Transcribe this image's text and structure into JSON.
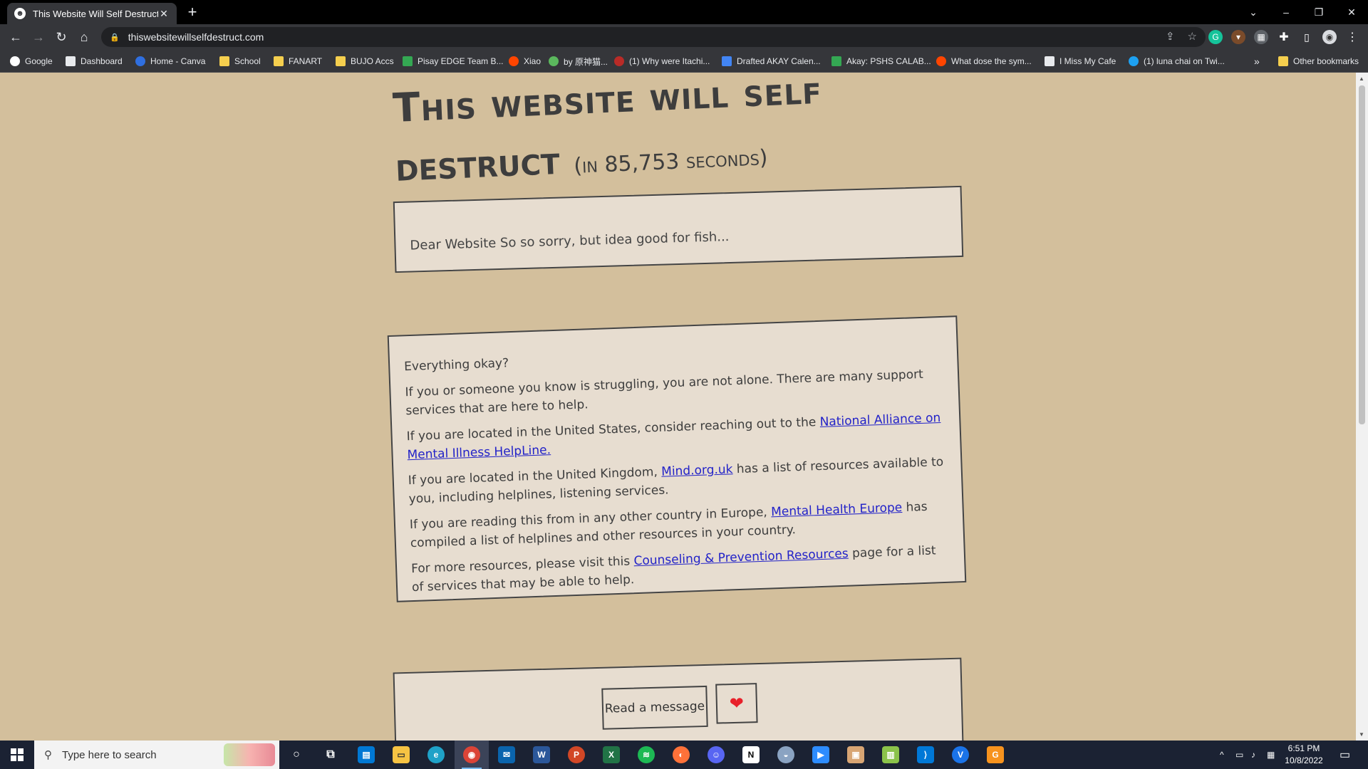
{
  "browser": {
    "tab_title": "This Website Will Self Destruct",
    "tab_close": "✕",
    "new_tab": "+",
    "url": "thiswebsitewillselfdestruct.com",
    "bookmarks": [
      {
        "label": "Google",
        "icon": "google-icon",
        "color": "#ffffff"
      },
      {
        "label": "Dashboard",
        "icon": "dashboard-icon",
        "color": "#e8eaed"
      },
      {
        "label": "Home - Canva",
        "icon": "canva-icon",
        "color": "#2f6fe0"
      },
      {
        "label": "School",
        "icon": "folder-icon",
        "color": "#f5cf4e"
      },
      {
        "label": "FANART",
        "icon": "folder-icon",
        "color": "#f5cf4e"
      },
      {
        "label": "BUJO Accs",
        "icon": "folder-icon",
        "color": "#f5cf4e"
      },
      {
        "label": "Pisay EDGE Team B...",
        "icon": "drive-icon",
        "color": "#34a853"
      },
      {
        "label": "Xiao",
        "icon": "reddit-icon",
        "color": "#ff4500"
      },
      {
        "label": "by 原神猫...",
        "icon": "leaf-icon",
        "color": "#5bb85d"
      },
      {
        "label": "(1) Why were Itachi...",
        "icon": "quora-icon",
        "color": "#b92b27"
      },
      {
        "label": "Drafted AKAY Calen...",
        "icon": "docs-icon",
        "color": "#4285f4"
      },
      {
        "label": "Akay: PSHS CALAB...",
        "icon": "drive-icon",
        "color": "#34a853"
      },
      {
        "label": "What dose the sym...",
        "icon": "reddit-icon",
        "color": "#ff4500"
      },
      {
        "label": "I Miss My Cafe",
        "icon": "cafe-icon",
        "color": "#e8eaed"
      },
      {
        "label": "(1) luna chai on Twi...",
        "icon": "twitter-icon",
        "color": "#1da1f2"
      }
    ],
    "overflow": "»",
    "other_bookmarks": "Other bookmarks"
  },
  "page": {
    "title_line1": "This website will self",
    "title_line2": "destruct",
    "countdown": "(in 85,753 seconds)",
    "message_text": "Dear Website So so sorry, but idea good for fish...",
    "help": {
      "intro": "Everything okay?",
      "p1": "If you or someone you know is struggling, you are not alone. There are many support services that are here to help.",
      "p2_before": "If you are located in the United States, consider reaching out to the ",
      "p2_link": "National Alliance on Mental Illness HelpLine.",
      "p3_before": "If you are located in the United Kingdom, ",
      "p3_link": "Mind.org.uk",
      "p3_after": " has a list of resources available to you, including helplines, listening services.",
      "p4_before": "If you are reading this from in any other country in Europe, ",
      "p4_link": "Mental Health Europe",
      "p4_after": " has compiled a list of helplines and other resources in your country.",
      "p5_before": "For more resources, please visit this ",
      "p5_link": "Counseling & Prevention Resources",
      "p5_after": " page for a list of services that may be able to help."
    },
    "read_button": "Read a message",
    "heart_glyph": "❤"
  },
  "taskbar": {
    "search_placeholder": "Type here to search",
    "time": "6:51 PM",
    "date": "10/8/2022"
  }
}
